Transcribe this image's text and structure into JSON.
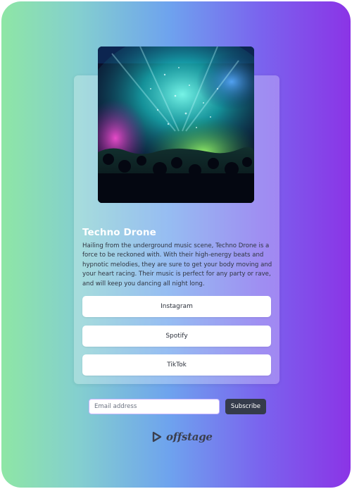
{
  "artist": {
    "name": "Techno Drone",
    "bio": "Hailing from the underground music scene, Techno Drone is a force to be reckoned with. With their high-energy beats and hypnotic melodies, they are sure to get your body moving and your heart racing. Their music is perfect for any party or rave, and will keep you dancing all night long."
  },
  "links": [
    {
      "label": "Instagram"
    },
    {
      "label": "Spotify"
    },
    {
      "label": "TikTok"
    }
  ],
  "subscribe": {
    "placeholder": "Email address",
    "button_label": "Subscribe"
  },
  "brand": {
    "name": "offstage",
    "icon": "play-triangle-icon"
  },
  "colors": {
    "gradient_start": "#8ee6a5",
    "gradient_mid": "#6ea3ee",
    "gradient_end": "#8b34e6",
    "button_dark": "#353b4b",
    "input_border": "#c9b6ff"
  }
}
